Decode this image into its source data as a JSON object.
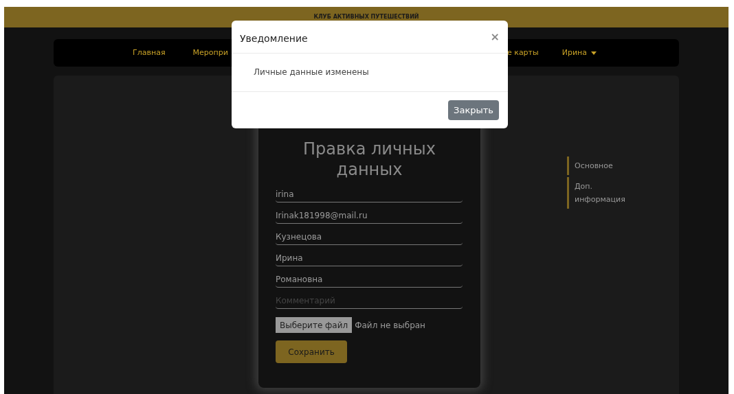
{
  "header": {
    "title": "КЛУБ АКТИВНЫХ ПУТЕШЕСТВИЙ"
  },
  "nav": {
    "items": [
      {
        "label": "Главная"
      },
      {
        "label": "Меропри"
      },
      {
        "label": "е карты"
      }
    ],
    "user": {
      "label": "Ирина"
    }
  },
  "form": {
    "title": "Правка личных данных",
    "fields": [
      {
        "value": "irina"
      },
      {
        "value": "Irinak181998@mail.ru"
      },
      {
        "value": "Кузнецова"
      },
      {
        "value": "Ирина"
      },
      {
        "value": "Романовна"
      },
      {
        "placeholder": "Комментарий"
      }
    ],
    "file": {
      "button": "Выберите файл",
      "status": "Файл не выбран"
    },
    "save": "Сохранить"
  },
  "side_menu": [
    {
      "label": "Основное"
    },
    {
      "label": "Доп. информация"
    }
  ],
  "modal": {
    "title": "Уведомление",
    "close": "×",
    "message": "Личные данные изменены",
    "button": "Закрыть"
  }
}
